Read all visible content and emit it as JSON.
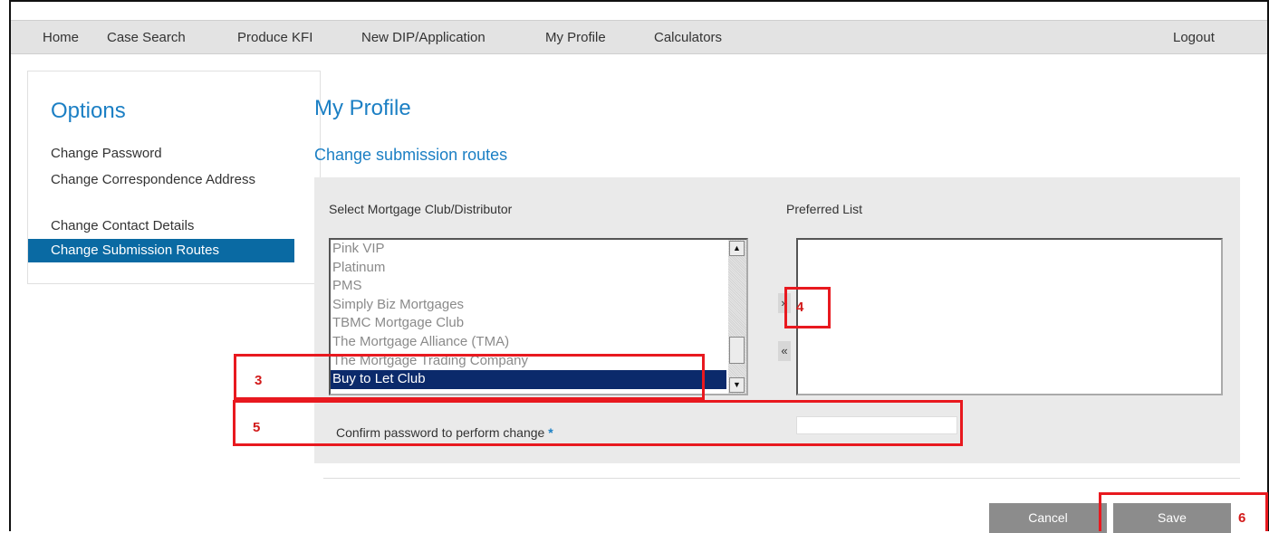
{
  "nav": {
    "items": [
      "Home",
      "Case Search",
      "Produce KFI",
      "New DIP/Application",
      "My Profile",
      "Calculators"
    ],
    "logout": "Logout"
  },
  "options": {
    "title": "Options",
    "links": [
      "Change Password",
      "Change Correspondence Address",
      "Change Contact Details"
    ],
    "active": "Change Submission Routes"
  },
  "main": {
    "title": "My Profile",
    "subtitle": "Change submission routes",
    "select_label": "Select Mortgage Club/Distributor",
    "preferred_label": "Preferred List",
    "club_items": [
      "Pink VIP",
      "Platinum",
      "PMS",
      "Simply Biz Mortgages",
      "TBMC Mortgage Club",
      "The Mortgage Alliance (TMA)",
      "The Mortgage Trading Company",
      "Buy to Let Club"
    ],
    "selected_item": "Buy to Let Club",
    "move_right": "»",
    "move_left": "«",
    "password_label": "Confirm password to perform change",
    "required_marker": "*",
    "password_value": "",
    "cancel": "Cancel",
    "save": "Save"
  },
  "annotations": [
    "3",
    "4",
    "5",
    "6"
  ],
  "colors": {
    "accent": "#1b7fc4",
    "active_option": "#0a6aa3",
    "selected_row": "#0b2a6b",
    "annotation": "#e8191f",
    "button": "#8c8c8c"
  }
}
